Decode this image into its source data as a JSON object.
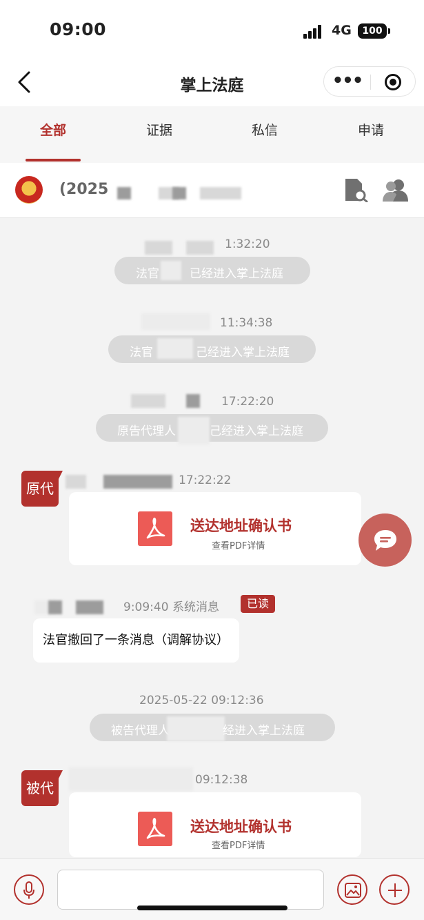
{
  "status_bar": {
    "time": "09:00",
    "network": "4G",
    "battery": "100"
  },
  "nav": {
    "title": "掌上法庭"
  },
  "tabs": [
    {
      "label": "全部",
      "active": true
    },
    {
      "label": "证据",
      "active": false
    },
    {
      "label": "私信",
      "active": false
    },
    {
      "label": "申请",
      "active": false
    }
  ],
  "case": {
    "number_prefix": "(2025"
  },
  "messages": {
    "m1": {
      "time": "1:32:20",
      "text_a": "法官",
      "text_b": "已经进入掌上法庭"
    },
    "m2": {
      "time": "11:34:38",
      "text_a": "法官",
      "text_b": "己经进入掌上法庭"
    },
    "m3": {
      "time": "17:22:20",
      "text_a": "原告代理人",
      "text_b": "己经进入掌上法庭"
    },
    "m4": {
      "avatar": "原代",
      "time": "17:22:22",
      "card_title": "送达地址确认书",
      "card_sub": "查看PDF详情"
    },
    "m5": {
      "time": "9:09:40 系统消息",
      "badge": "已读",
      "text": "法官撤回了一条消息（调解协议）"
    },
    "m6": {
      "time": "2025-05-22 09:12:36",
      "text_a": "被告代理人",
      "text_b": "经进入掌上法庭"
    },
    "m7": {
      "avatar": "被代",
      "time": "09:12:38",
      "card_title": "送达地址确认书",
      "card_sub": "查看PDF详情"
    }
  },
  "colors": {
    "accent": "#b2312d",
    "pdf": "#ec5b56",
    "system_bubble": "#d9d9d9",
    "fab": "#c7625c"
  },
  "icons": [
    "chevron-left-icon",
    "more-icon",
    "target-icon",
    "court-emblem-icon",
    "doc-search-icon",
    "users-icon",
    "pdf-icon",
    "chat-icon",
    "mic-icon",
    "image-icon",
    "plus-icon"
  ]
}
